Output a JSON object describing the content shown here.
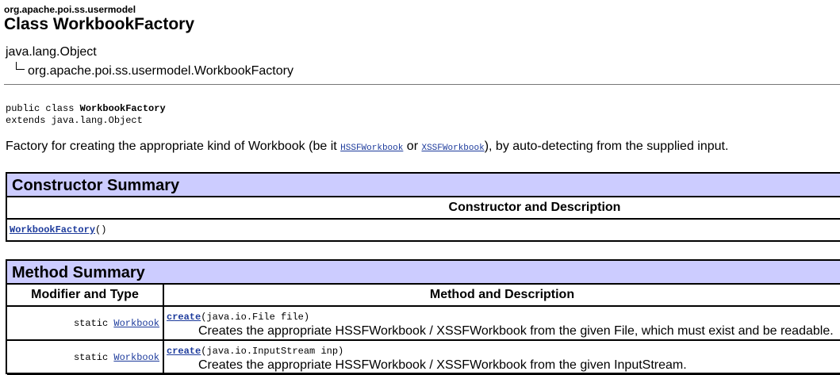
{
  "header": {
    "package": "org.apache.poi.ss.usermodel",
    "title": "Class WorkbookFactory"
  },
  "inheritance": {
    "parent": "java.lang.Object",
    "child": "org.apache.poi.ss.usermodel.WorkbookFactory"
  },
  "declaration": {
    "line1_prefix": "public class ",
    "line1_name": "WorkbookFactory",
    "line2": "extends java.lang.Object"
  },
  "description": {
    "pre": "Factory for creating the appropriate kind of Workbook (be it ",
    "link1": "HSSFWorkbook",
    "mid": " or ",
    "link2": "XSSFWorkbook",
    "post": "), by auto-detecting from the supplied input."
  },
  "constructor_summary": {
    "title": "Constructor Summary",
    "column": "Constructor and Description",
    "rows": [
      {
        "name": "WorkbookFactory",
        "args": "()"
      }
    ]
  },
  "method_summary": {
    "title": "Method Summary",
    "col1": "Modifier and Type",
    "col2": "Method and Description",
    "rows": [
      {
        "modifier": "static ",
        "type": "Workbook",
        "method": "create",
        "params": "(java.io.File file)",
        "description": "Creates the appropriate HSSFWorkbook / XSSFWorkbook from the given File, which must exist and be readable."
      },
      {
        "modifier": "static ",
        "type": "Workbook",
        "method": "create",
        "params": "(java.io.InputStream inp)",
        "description": "Creates the appropriate HSSFWorkbook / XSSFWorkbook from the given InputStream."
      }
    ]
  }
}
